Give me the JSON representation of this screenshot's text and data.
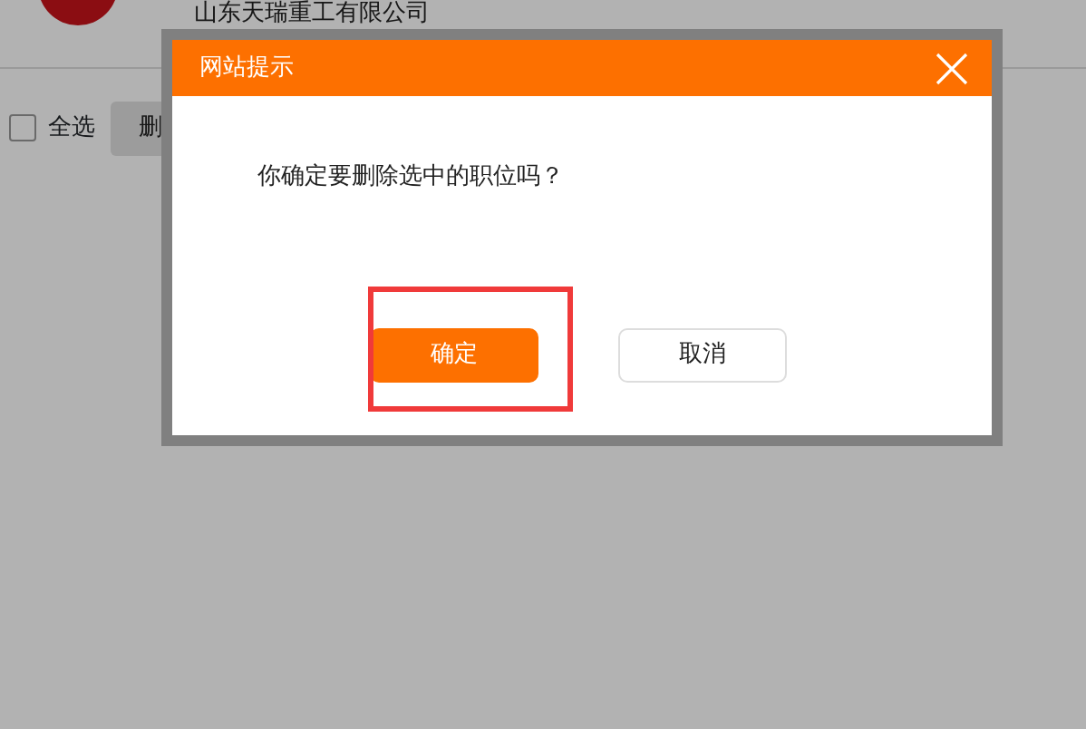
{
  "page": {
    "company": "山东天瑞重工有限公司",
    "select_all": {
      "label": "全选",
      "checked": false
    },
    "delete_button": "删"
  },
  "dialog": {
    "title": "网站提示",
    "message": "你确定要删除选中的职位吗？",
    "buttons": [
      {
        "label": "确定",
        "kind": "primary"
      },
      {
        "label": "取消",
        "kind": "secondary"
      }
    ]
  }
}
